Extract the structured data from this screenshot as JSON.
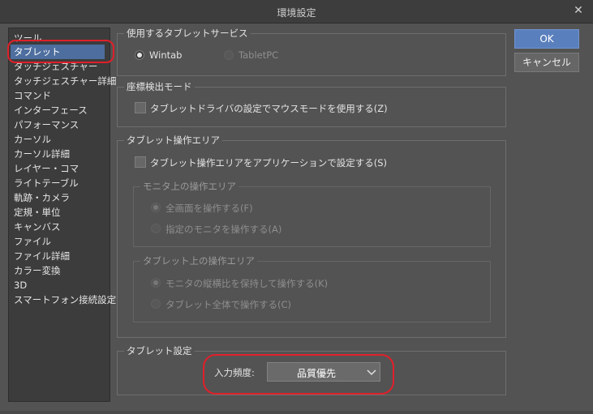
{
  "window": {
    "title": "環境設定",
    "close_icon": "close-icon"
  },
  "sidebar": {
    "items": [
      {
        "label": "ツール",
        "selected": false
      },
      {
        "label": "タブレット",
        "selected": true
      },
      {
        "label": "タッチジェスチャー",
        "selected": false
      },
      {
        "label": "タッチジェスチャー詳細",
        "selected": false
      },
      {
        "label": "コマンド",
        "selected": false
      },
      {
        "label": "インターフェース",
        "selected": false
      },
      {
        "label": "パフォーマンス",
        "selected": false
      },
      {
        "label": "カーソル",
        "selected": false
      },
      {
        "label": "カーソル詳細",
        "selected": false
      },
      {
        "label": "レイヤー・コマ",
        "selected": false
      },
      {
        "label": "ライトテーブル",
        "selected": false
      },
      {
        "label": "軌跡・カメラ",
        "selected": false
      },
      {
        "label": "定規・単位",
        "selected": false
      },
      {
        "label": "キャンバス",
        "selected": false
      },
      {
        "label": "ファイル",
        "selected": false
      },
      {
        "label": "ファイル詳細",
        "selected": false
      },
      {
        "label": "カラー変換",
        "selected": false
      },
      {
        "label": "3D",
        "selected": false
      },
      {
        "label": "スマートフォン接続設定",
        "selected": false
      }
    ]
  },
  "tablet_service": {
    "legend": "使用するタブレットサービス",
    "options": [
      {
        "label": "Wintab",
        "selected": true,
        "enabled": true
      },
      {
        "label": "TabletPC",
        "selected": false,
        "enabled": false
      }
    ]
  },
  "coordinate_mode": {
    "legend": "座標検出モード",
    "checkbox_label": "タブレットドライバの設定でマウスモードを使用する(Z)",
    "checked": false
  },
  "operation_area": {
    "legend": "タブレット操作エリア",
    "checkbox_label": "タブレット操作エリアをアプリケーションで設定する(S)",
    "checked": false,
    "monitor_area": {
      "legend": "モニタ上の操作エリア",
      "options": [
        {
          "label": "全画面を操作する(F)",
          "selected": true
        },
        {
          "label": "指定のモニタを操作する(A)",
          "selected": false
        }
      ]
    },
    "tablet_area": {
      "legend": "タブレット上の操作エリア",
      "options": [
        {
          "label": "モニタの縦横比を保持して操作する(K)",
          "selected": true
        },
        {
          "label": "タブレット全体で操作する(C)",
          "selected": false
        }
      ]
    }
  },
  "tablet_settings": {
    "legend": "タブレット設定",
    "input_frequency_label": "入力頻度:",
    "input_frequency_value": "品質優先"
  },
  "buttons": {
    "ok": "OK",
    "cancel": "キャンセル"
  },
  "colors": {
    "background": "#535353",
    "selection": "#4d6e9e",
    "ok_button": "#5a7fbd",
    "annotation_ring": "#e0202a"
  }
}
